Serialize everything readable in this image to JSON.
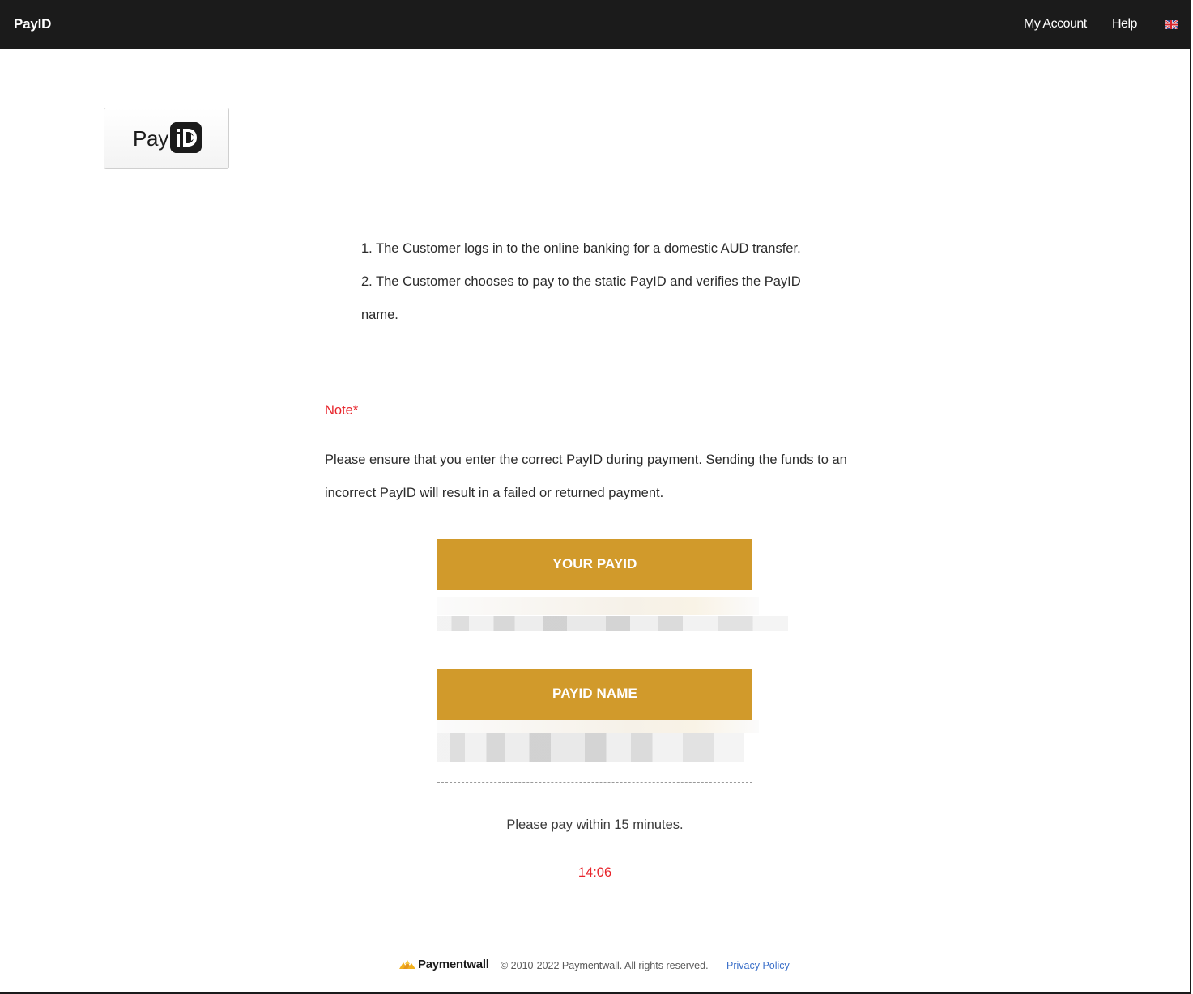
{
  "topbar": {
    "brand": "PayID",
    "nav": {
      "my_account": "My Account",
      "help": "Help"
    },
    "language_icon": "uk-flag-icon"
  },
  "logo": {
    "pay_text": "Pay",
    "id_mark_icon": "payid-logo-icon"
  },
  "instructions": {
    "step1": "1. The Customer logs in to the online banking for a domestic AUD transfer.",
    "step2": "2. The Customer chooses to pay to the static PayID and verifies the PayID name."
  },
  "note": {
    "label": "Note*",
    "text": "Please ensure that you enter the correct PayID during payment. Sending the funds to an incorrect PayID will result in a failed or returned payment."
  },
  "payid_section": {
    "header": "YOUR PAYID"
  },
  "payid_name_section": {
    "header": "PAYID NAME"
  },
  "timer": {
    "message": "Please pay within 15 minutes.",
    "countdown": "14:06"
  },
  "footer": {
    "brand": "Paymentwall",
    "copyright": "© 2010-2022 Paymentwall. All rights reserved.",
    "privacy_link": "Privacy Policy"
  },
  "colors": {
    "topbar_bg": "#1b1b1b",
    "accent_gold": "#d19a2b",
    "alert_red": "#e8242b",
    "link_blue": "#3a6fc9"
  }
}
